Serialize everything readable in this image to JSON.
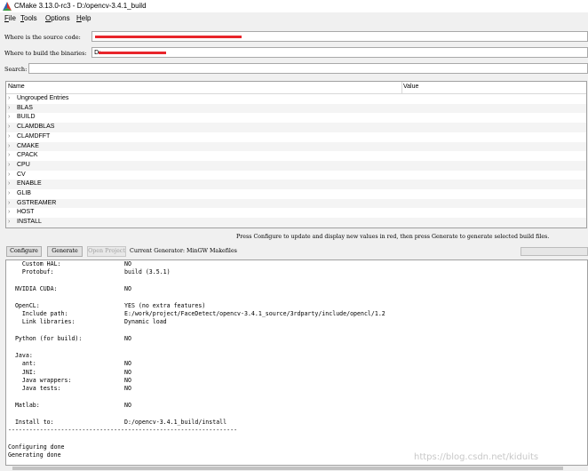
{
  "window": {
    "title": "CMake 3.13.0-rc3 - D:/opencv-3.4.1_build"
  },
  "menu": [
    {
      "key": "F",
      "rest": "ile"
    },
    {
      "key": "T",
      "rest": "ools"
    },
    {
      "key": "O",
      "rest": "ptions"
    },
    {
      "key": "H",
      "rest": "elp"
    }
  ],
  "source": {
    "label": "Where is the source code:"
  },
  "build": {
    "label": "Where to build the binaries:",
    "value": "D:"
  },
  "search": {
    "label": "Search:",
    "value": ""
  },
  "table": {
    "columns": [
      "Name",
      "Value"
    ],
    "rows": [
      "Ungrouped Entries",
      "BLAS",
      "BUILD",
      "CLAMDBLAS",
      "CLAMDFFT",
      "CMAKE",
      "CPACK",
      "CPU",
      "CV",
      "ENABLE",
      "GLIB",
      "GSTREAMER",
      "HOST",
      "INSTALL"
    ]
  },
  "hint": "Press Configure to update and display new values in red, then press Generate to generate selected build files.",
  "buttons": {
    "configure": "Configure",
    "generate": "Generate",
    "open_project": "Open Project"
  },
  "generator": "Current Generator: MinGW Makefiles",
  "output_lines": [
    "    Custom HAL:                  NO",
    "    Protobuf:                    build (3.5.1)",
    "",
    "  NVIDIA CUDA:                   NO",
    "",
    "  OpenCL:                        YES (no extra features)",
    "    Include path:                E:/work/project/FaceDetect/opencv-3.4.1_source/3rdparty/include/opencl/1.2",
    "    Link libraries:              Dynamic load",
    "",
    "  Python (for build):            NO",
    "",
    "  Java:",
    "    ant:                         NO",
    "    JNI:                         NO",
    "    Java wrappers:               NO",
    "    Java tests:                  NO",
    "",
    "  Matlab:                        NO",
    "",
    "  Install to:                    D:/opencv-3.4.1_build/install",
    "-----------------------------------------------------------------",
    "",
    "Configuring done",
    "Generating done"
  ],
  "watermark": "https://blog.csdn.net/kiduits",
  "colors": {
    "redaction": "#e8252b",
    "icon_red": "#d9342b",
    "icon_blue": "#2f63b5",
    "icon_green": "#3a9a3a"
  }
}
